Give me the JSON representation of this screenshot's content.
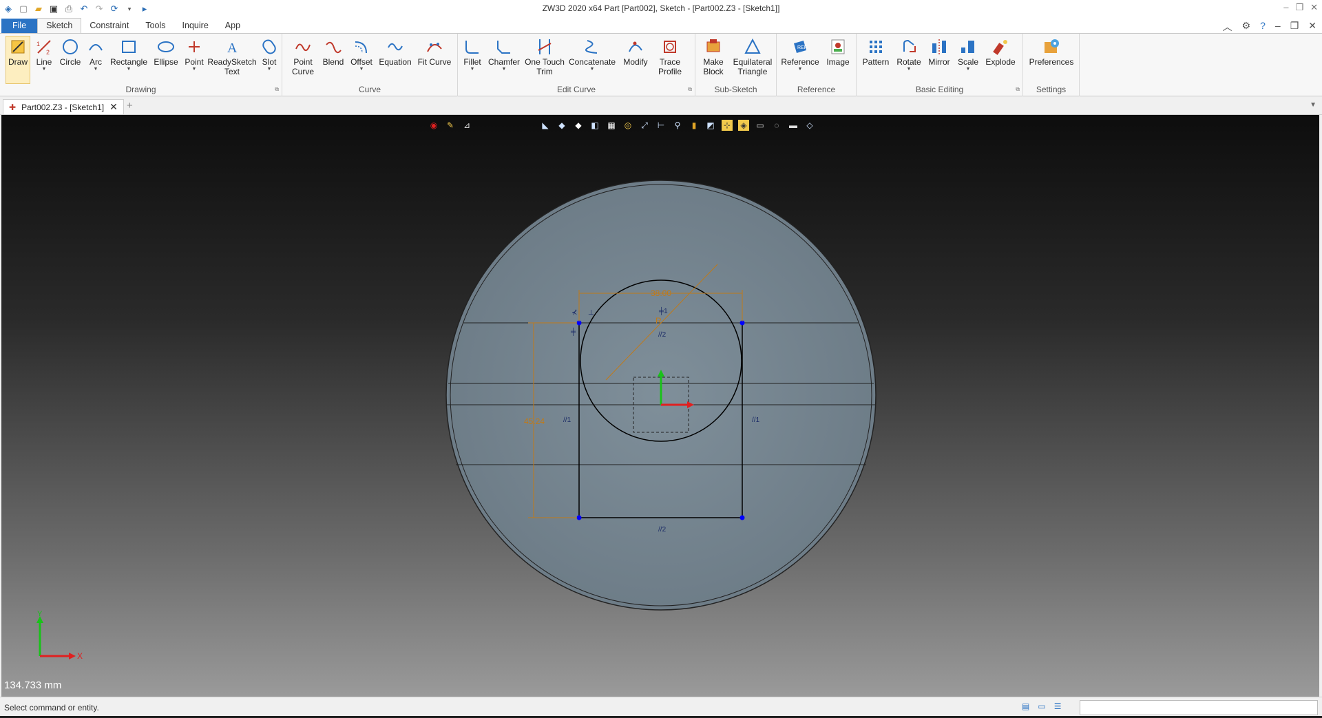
{
  "window": {
    "title": "ZW3D 2020 x64        Part [Part002],  Sketch - [Part002.Z3 - [Sketch1]]"
  },
  "menu": {
    "tabs": [
      "File",
      "Sketch",
      "Constraint",
      "Tools",
      "Inquire",
      "App"
    ],
    "active": "Sketch"
  },
  "ribbon": {
    "groups": {
      "drawing": "Drawing",
      "curve": "Curve",
      "edit_curve": "Edit Curve",
      "sub_sketch": "Sub-Sketch",
      "reference": "Reference",
      "basic_editing": "Basic Editing",
      "settings": "Settings"
    },
    "buttons": {
      "draw": "Draw",
      "line": "Line",
      "circle": "Circle",
      "arc": "Arc",
      "rectangle": "Rectangle",
      "ellipse": "Ellipse",
      "point": "Point",
      "readysketch_1": "ReadySketch",
      "readysketch_2": "Text",
      "slot": "Slot",
      "point_curve_1": "Point",
      "point_curve_2": "Curve",
      "blend": "Blend",
      "offset": "Offset",
      "equation": "Equation",
      "fit_curve": "Fit Curve",
      "fillet": "Fillet",
      "chamfer": "Chamfer",
      "one_touch_1": "One Touch",
      "one_touch_2": "Trim",
      "concatenate": "Concatenate",
      "modify": "Modify",
      "trace_1": "Trace",
      "trace_2": "Profile",
      "make_block_1": "Make",
      "make_block_2": "Block",
      "equilateral_1": "Equilateral",
      "equilateral_2": "Triangle",
      "reference": "Reference",
      "image": "Image",
      "pattern": "Pattern",
      "rotate": "Rotate",
      "mirror": "Mirror",
      "scale": "Scale",
      "explode": "Explode",
      "preferences": "Preferences"
    }
  },
  "document_tab": {
    "label": "Part002.Z3 - [Sketch1]"
  },
  "viewport": {
    "dimensions": {
      "width_label": "38.00",
      "radius_label": "R",
      "height_label": "45.24"
    },
    "constraints": {
      "c1": "1",
      "c2": "2",
      "c3": "1",
      "c4": "1",
      "c5": "2"
    },
    "axis_x": "X",
    "axis_y": "Y",
    "measurement": "134.733 mm"
  },
  "status": {
    "prompt": "Select command or entity."
  },
  "colors": {
    "accent": "#2b73c4",
    "dimension": "#c07a18",
    "sketch_point": "#0000ff",
    "highlight": "#f2c94c"
  }
}
